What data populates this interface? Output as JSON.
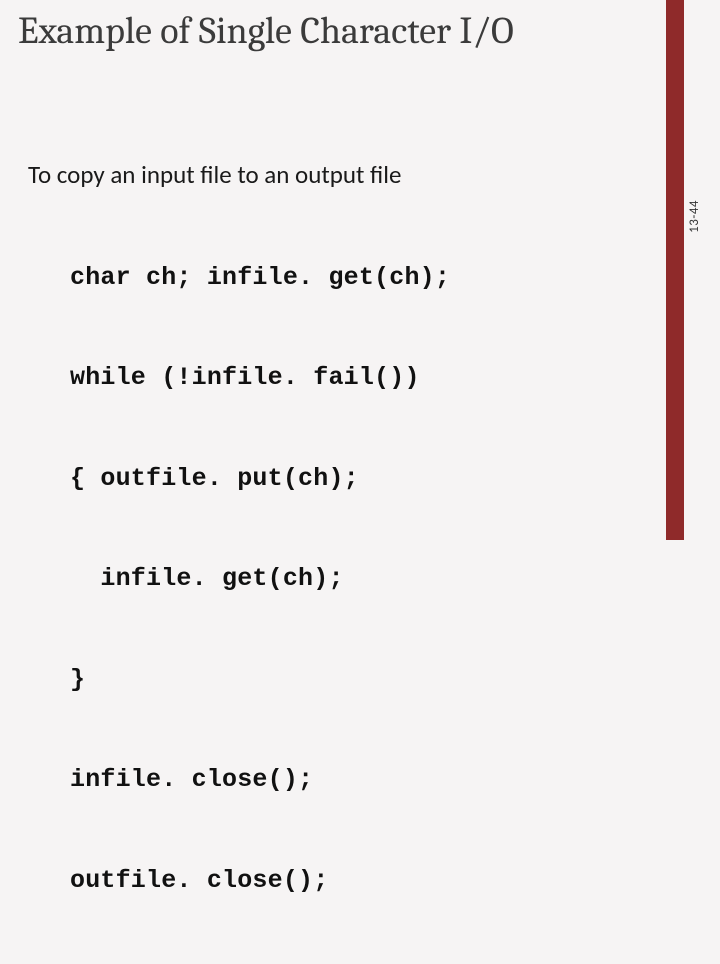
{
  "slide": {
    "title": "Example of Single Character I/O",
    "intro": "To copy an input file to an output file",
    "code_lines": [
      "char ch; infile. get(ch);",
      "while (!infile. fail())",
      "{ outfile. put(ch);",
      "  infile. get(ch);",
      "}",
      "infile. close();",
      "outfile. close();"
    ],
    "page_number": "13-44"
  },
  "colors": {
    "accent": "#8f2a2a",
    "background": "#f6f4f4"
  }
}
